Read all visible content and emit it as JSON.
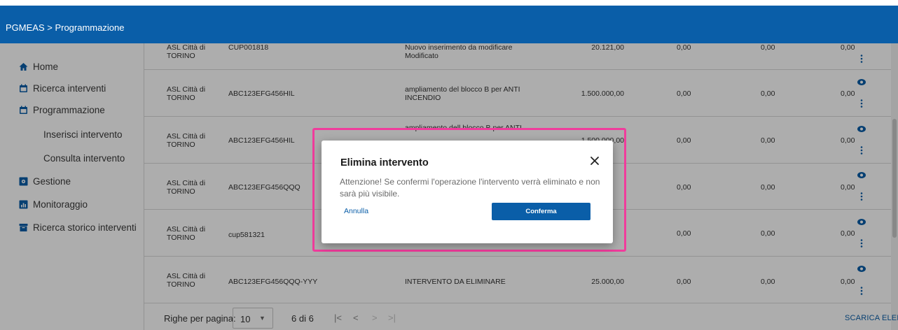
{
  "header": {
    "breadcrumb": "PGMEAS > Programmazione",
    "bar_color": "#0a5ea8"
  },
  "sidebar": {
    "items": [
      {
        "label": "Home",
        "icon": "home-icon"
      },
      {
        "label": "Ricerca interventi",
        "icon": "calendar-icon"
      },
      {
        "label": "Programmazione",
        "icon": "calendar-icon"
      },
      {
        "label": "Inserisci intervento",
        "icon": ""
      },
      {
        "label": "Consulta intervento",
        "icon": ""
      },
      {
        "label": "Gestione",
        "icon": "settings-icon"
      },
      {
        "label": "Monitoraggio",
        "icon": "chart-icon"
      },
      {
        "label": "Ricerca storico interventi",
        "icon": "archive-icon"
      }
    ]
  },
  "table": {
    "rows": [
      {
        "asl": "ASL Città di TORINO",
        "cup": "CUP001818",
        "desc": "Nuovo inserimento da modificare Modificato",
        "importo": "20.121,00",
        "v1": "0,00",
        "v2": "0,00",
        "v3": "0,00"
      },
      {
        "asl": "ASL Città di TORINO",
        "cup": "ABC123EFG456HIL",
        "desc": "ampliamento del blocco B per ANTI INCENDIO",
        "importo": "1.500.000,00",
        "v1": "0,00",
        "v2": "0,00",
        "v3": "0,00"
      },
      {
        "asl": "ASL Città di TORINO",
        "cup": "ABC123EFG456HIL",
        "desc": "ampliamento dell blocco B per ANTI",
        "importo": "1.500.000,00",
        "v1": "0,00",
        "v2": "0,00",
        "v3": "0,00"
      },
      {
        "asl": "ASL Città di TORINO",
        "cup": "ABC123EFG456QQQ",
        "desc": "",
        "importo": "",
        "v1": "0,00",
        "v2": "0,00",
        "v3": "0,00"
      },
      {
        "asl": "ASL Città di TORINO",
        "cup": "cup581321",
        "desc": "",
        "importo": "",
        "v1": "0,00",
        "v2": "0,00",
        "v3": "0,00"
      },
      {
        "asl": "ASL Città di TORINO",
        "cup": "ABC123EFG456QQQ-YYY",
        "desc": "INTERVENTO DA ELIMINARE",
        "importo": "25.000,00",
        "v1": "0,00",
        "v2": "0,00",
        "v3": "0,00"
      }
    ]
  },
  "footer": {
    "rows_per_page_label": "Righe per pagina:",
    "rows_per_page_value": "10",
    "page_count": "6 di 6",
    "download_label": "SCARICA ELENCO"
  },
  "dialog": {
    "title": "Elimina intervento",
    "message": "Attenzione! Se confermi l'operazione l'intervento verrà eliminato e non sarà più visibile.",
    "cancel_label": "Annulla",
    "confirm_label": "Conferma",
    "highlight_color": "#f03c9c"
  }
}
